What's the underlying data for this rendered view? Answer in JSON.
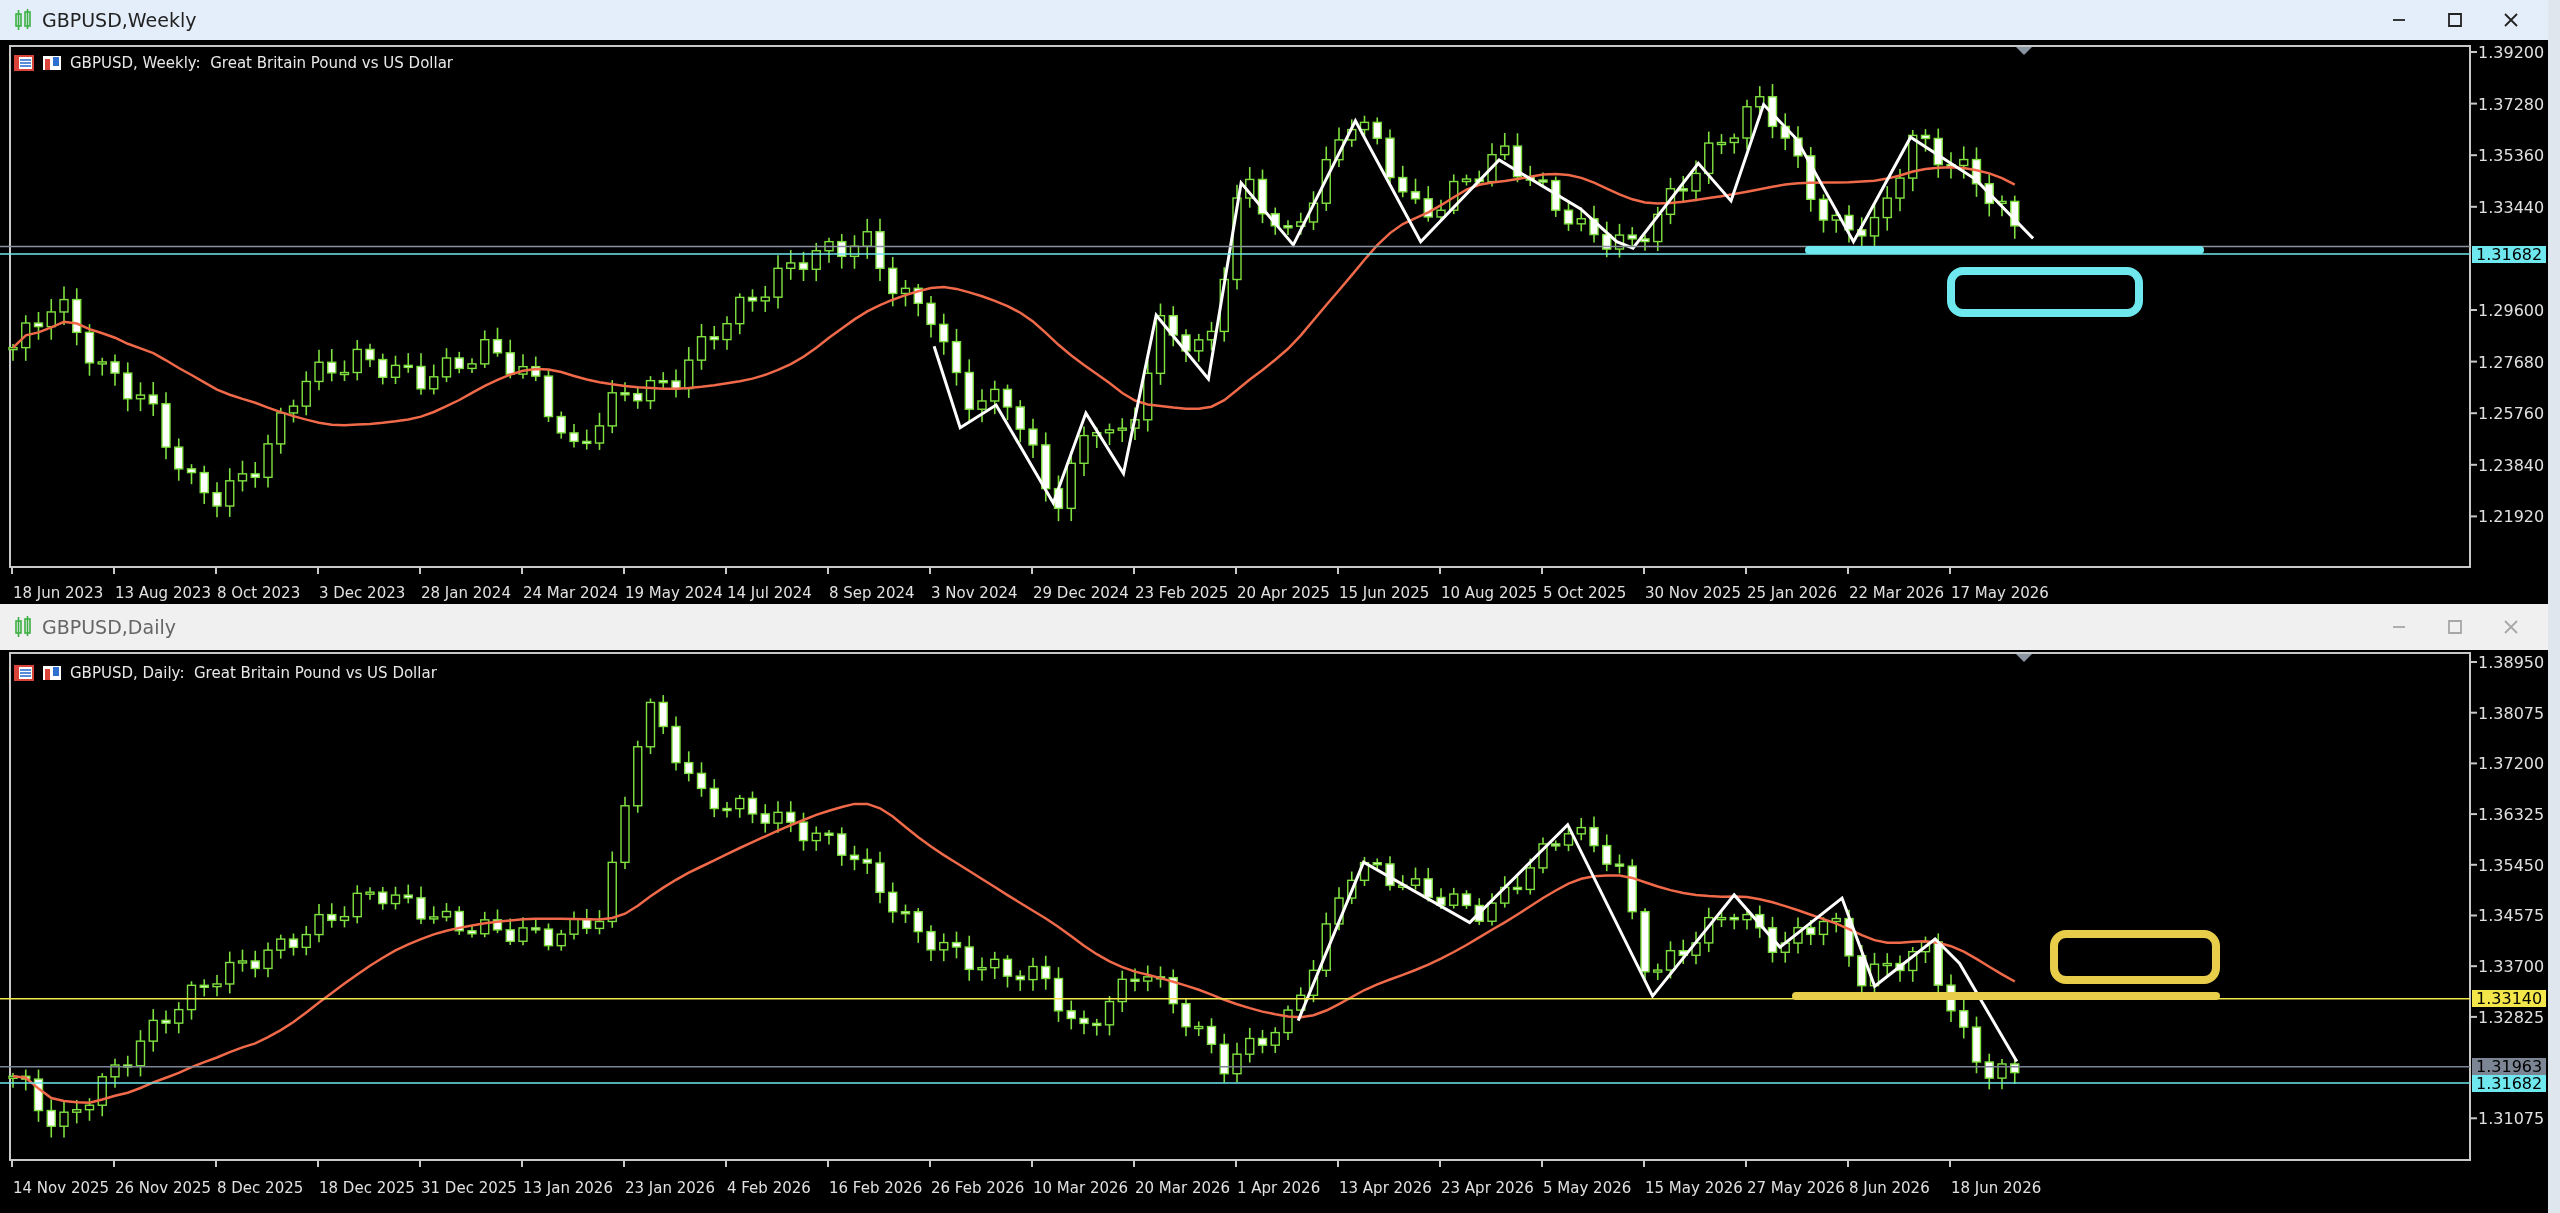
{
  "windows": [
    {
      "title": "GBPUSD,Weekly",
      "active": true,
      "chart_header": "GBPUSD, Weekly:  Great Britain Pound vs US Dollar",
      "price_labels": [
        "1.39200",
        "1.37280",
        "1.35360",
        "1.33440",
        "1.29600",
        "1.27680",
        "1.25760",
        "1.23840",
        "1.21920"
      ],
      "date_labels": [
        "18 Jun 2023",
        "13 Aug 2023",
        "8 Oct 2023",
        "3 Dec 2023",
        "28 Jan 2024",
        "24 Mar 2024",
        "19 May 2024",
        "14 Jul 2024",
        "8 Sep 2024",
        "3 Nov 2024",
        "29 Dec 2024",
        "23 Feb 2025",
        "20 Apr 2025",
        "15 Jun 2025",
        "10 Aug 2025",
        "5 Oct 2025",
        "30 Nov 2025",
        "25 Jan 2026",
        "22 Mar 2026",
        "17 May 2026"
      ],
      "tags": [
        {
          "text": "1.31682",
          "color": "#6ee8ee"
        }
      ]
    },
    {
      "title": "GBPUSD,Daily",
      "active": false,
      "chart_header": "GBPUSD, Daily:  Great Britain Pound vs US Dollar",
      "price_labels": [
        "1.38950",
        "1.38075",
        "1.37200",
        "1.36325",
        "1.35450",
        "1.34575",
        "1.33700",
        "1.32825",
        "1.31075"
      ],
      "date_labels": [
        "14 Nov 2025",
        "26 Nov 2025",
        "8 Dec 2025",
        "18 Dec 2025",
        "31 Dec 2025",
        "13 Jan 2026",
        "23 Jan 2026",
        "4 Feb 2026",
        "16 Feb 2026",
        "26 Feb 2026",
        "10 Mar 2026",
        "20 Mar 2026",
        "1 Apr 2026",
        "13 Apr 2026",
        "23 Apr 2026",
        "5 May 2026",
        "15 May 2026",
        "27 May 2026",
        "8 Jun 2026",
        "18 Jun 2026"
      ],
      "tags": [
        {
          "text": "1.33140",
          "color": "#f2e64a"
        },
        {
          "text": "1.31963",
          "color": "#7b8593"
        },
        {
          "text": "1.31682",
          "color": "#6ee8ee"
        }
      ]
    }
  ]
}
